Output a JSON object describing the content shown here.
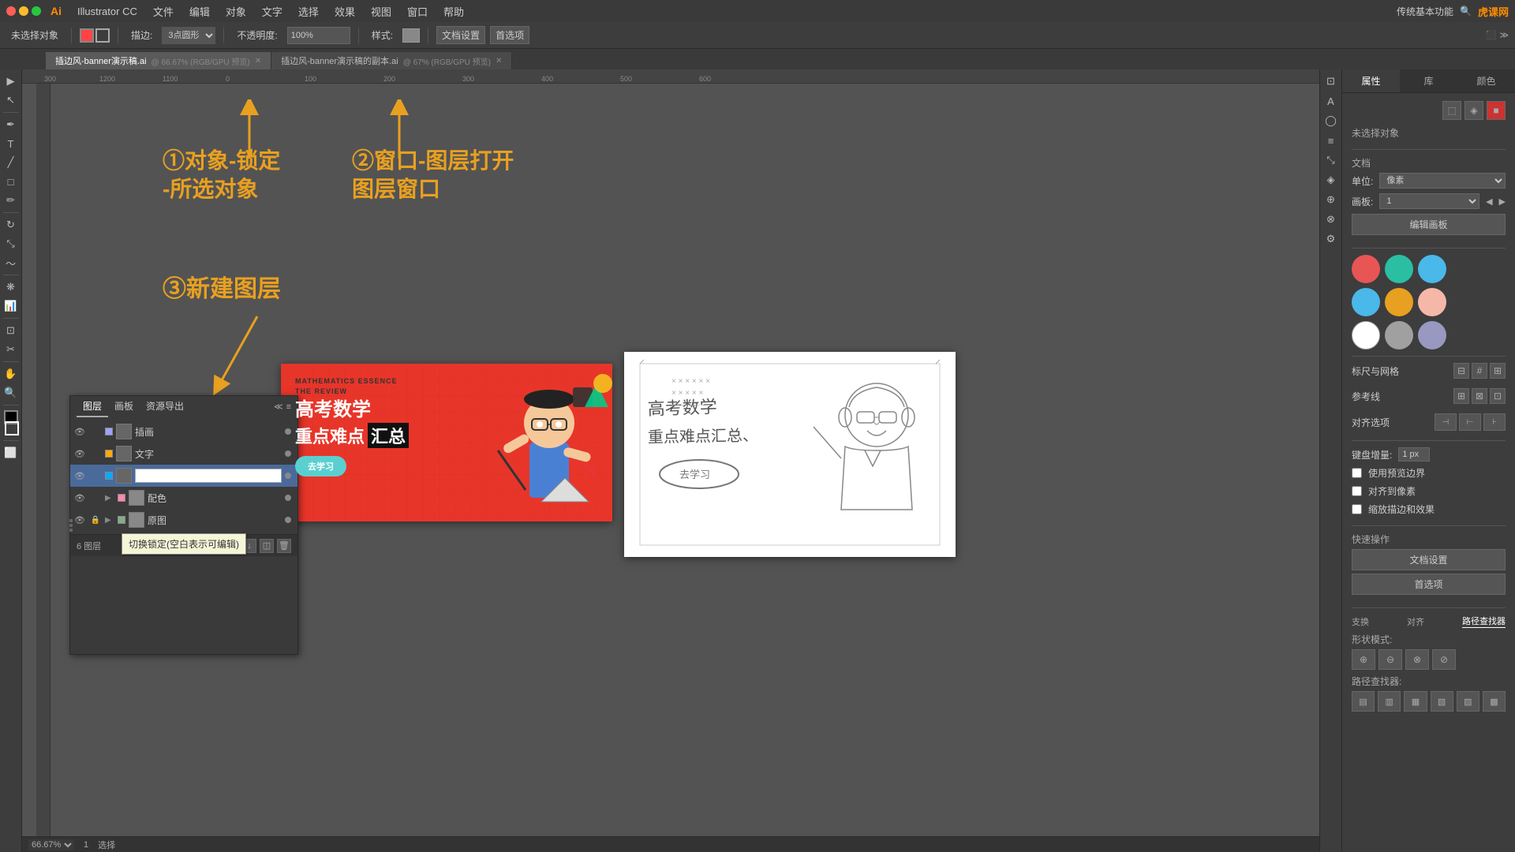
{
  "app": {
    "title": "Illustrator CC",
    "logo": "Ai"
  },
  "traffic_lights": {
    "close": "close",
    "minimize": "minimize",
    "maximize": "maximize"
  },
  "menu": {
    "items": [
      "文件",
      "编辑",
      "对象",
      "文字",
      "选择",
      "效果",
      "视图",
      "窗口",
      "帮助"
    ]
  },
  "toolbar": {
    "no_selection": "未选择对象",
    "stroke_label": "描边:",
    "stroke_value": "3点圆形",
    "opacity_label": "不透明度:",
    "opacity_value": "100%",
    "style_label": "样式:",
    "doc_settings": "文档设置",
    "preferences": "首选项"
  },
  "tabs": [
    {
      "name": "插边风-banner演示稿.ai",
      "detail": "66.67% (RGB/GPU 预览)",
      "active": true
    },
    {
      "name": "插边风-banner演示稿的副本.ai",
      "detail": "67% (RGB/GPU 预览)",
      "active": false
    }
  ],
  "annotations": {
    "step1": "①对象-锁定\n-所选对象",
    "step2": "②窗口-图层打开\n图层窗口",
    "step3": "③新建图层"
  },
  "layers_panel": {
    "tabs": [
      "图层",
      "画板",
      "资源导出"
    ],
    "layers": [
      {
        "name": "插画",
        "visible": true,
        "locked": false,
        "color": "#a0a0ff"
      },
      {
        "name": "文字",
        "visible": true,
        "locked": false,
        "color": "#ffaa00"
      },
      {
        "name": "",
        "visible": true,
        "locked": false,
        "color": "#00aaff",
        "active": true,
        "editing": true
      },
      {
        "name": "配色",
        "visible": true,
        "locked": false,
        "color": "#ff88aa",
        "hasChildren": true
      },
      {
        "name": "原图",
        "visible": true,
        "locked": true,
        "color": "#88aa88",
        "hasChildren": true
      }
    ],
    "footer": {
      "layer_count": "6 图层"
    }
  },
  "tooltip": {
    "text": "切换锁定(空白表示可编辑)"
  },
  "right_panel": {
    "tabs": [
      "属性",
      "库",
      "颜色"
    ],
    "active_tab": "属性",
    "no_selection": "未选择对象",
    "document_section": "文档",
    "unit_label": "单位:",
    "unit_value": "像素",
    "artboard_label": "画板:",
    "artboard_value": "1",
    "edit_artboard_btn": "编辑画板",
    "colors": [
      {
        "hex": "#e85555",
        "label": "red"
      },
      {
        "hex": "#2abfa3",
        "label": "teal"
      },
      {
        "hex": "#4ab8e8",
        "label": "lightblue"
      },
      {
        "hex": "#4ab8e8",
        "label": "cyan"
      },
      {
        "hex": "#e8a020",
        "label": "orange"
      },
      {
        "hex": "#f5b8a8",
        "label": "peach"
      },
      {
        "hex": "#ffffff",
        "label": "white"
      },
      {
        "hex": "#a0a0a0",
        "label": "gray"
      },
      {
        "hex": "#9898c0",
        "label": "purple-gray"
      }
    ],
    "snap_section": "标尺与网格",
    "guides_section": "参考线",
    "align_section": "对齐选项",
    "quick_actions": "快速操作",
    "keyboard_increment": "键盘增量:",
    "keyboard_value": "1 px",
    "use_preview_bounds": "使用预览边界",
    "align_to_pixel": "对齐到像素",
    "snap_edge": "缩放描边和效果",
    "doc_settings_btn": "文档设置",
    "preferences_btn": "首选项"
  },
  "path_panel": {
    "title": "路径查找器",
    "shape_modes_label": "形状模式:",
    "path_finder_label": "路径查找器:"
  },
  "status_bar": {
    "zoom": "66.67%",
    "artboard": "1",
    "tool": "选择"
  },
  "banner": {
    "subtitle": "MATHEMATICS ESSENCE\nTHE REVIEW",
    "title_line1": "高考数学",
    "title_line2_part1": "重点难点",
    "title_line2_part2": "汇总",
    "button_text": "去学习"
  }
}
